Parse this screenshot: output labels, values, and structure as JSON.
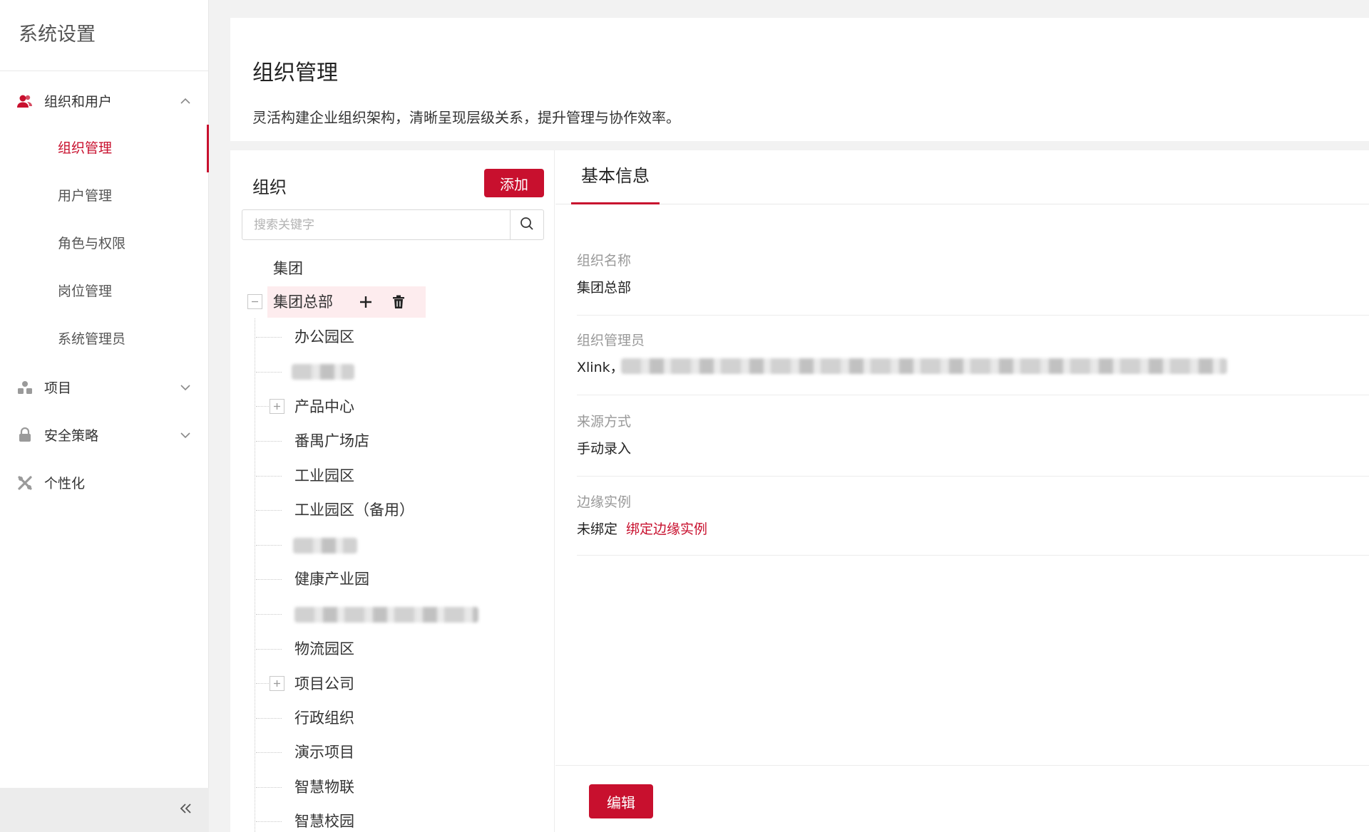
{
  "sidebar": {
    "title": "系统设置",
    "groups": [
      {
        "label": "组织和用户",
        "icon": "users-icon",
        "expanded": true,
        "items": [
          {
            "label": "组织管理",
            "active": true
          },
          {
            "label": "用户管理"
          },
          {
            "label": "角色与权限"
          },
          {
            "label": "岗位管理"
          },
          {
            "label": "系统管理员"
          }
        ]
      },
      {
        "label": "项目",
        "icon": "project-icon",
        "expanded": false
      },
      {
        "label": "安全策略",
        "icon": "lock-icon",
        "expanded": false
      },
      {
        "label": "个性化",
        "icon": "personalize-icon",
        "expanded": false
      }
    ],
    "collapse_icon": "double-chevron-left-icon"
  },
  "header": {
    "title": "组织管理",
    "description": "灵活构建企业组织架构，清晰呈现层级关系，提升管理与协作效率。"
  },
  "org_panel": {
    "title": "组织",
    "add_label": "添加",
    "search_placeholder": "搜索关键字",
    "tree": {
      "root": "集团",
      "selected": "集团总部",
      "children": [
        {
          "label": "办公园区"
        },
        {
          "label": "",
          "redacted": true
        },
        {
          "label": "产品中心",
          "expandable": true
        },
        {
          "label": "番禺广场店"
        },
        {
          "label": "工业园区"
        },
        {
          "label": "工业园区（备用）"
        },
        {
          "label": "",
          "redacted": true
        },
        {
          "label": "健康产业园"
        },
        {
          "label": "",
          "redacted": true
        },
        {
          "label": "物流园区"
        },
        {
          "label": "项目公司",
          "expandable": true
        },
        {
          "label": "行政组织"
        },
        {
          "label": "演示项目"
        },
        {
          "label": "智慧物联"
        },
        {
          "label": "智慧校园"
        }
      ]
    }
  },
  "detail": {
    "tab_label": "基本信息",
    "fields": {
      "name": {
        "label": "组织名称",
        "value": "集团总部"
      },
      "admin": {
        "label": "组织管理员",
        "value": "Xlink，"
      },
      "source": {
        "label": "来源方式",
        "value": "手动录入"
      },
      "edge": {
        "label": "边缘实例",
        "value": "未绑定",
        "link": "绑定边缘实例"
      }
    },
    "edit_label": "编辑"
  },
  "colors": {
    "accent": "#c8102e",
    "selected_bg": "#fdecee"
  }
}
